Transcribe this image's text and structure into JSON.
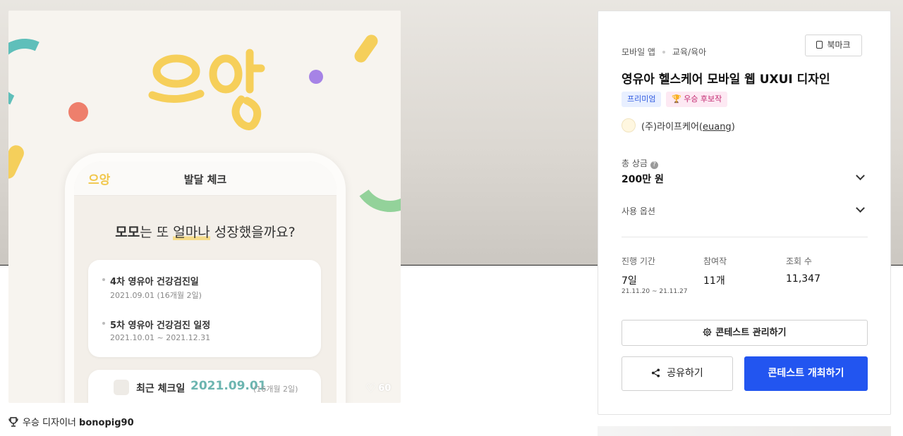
{
  "artwork": {
    "logo": "으앙",
    "phone": {
      "logo": "으앙",
      "title": "발달 체크",
      "question_name": "모모",
      "question_mid": "는 또 ",
      "question_hl": "얼마나",
      "question_end": " 성장했을까요?",
      "events": [
        {
          "title": "4차 영유아 건강검진일",
          "date": "2021.09.01 (16개월 2일)"
        },
        {
          "title": "5차 영유아 건강검진 일정",
          "date": "2021.10.01 ~ 2021.12.31"
        }
      ],
      "recent": {
        "label": "최근 체크일",
        "date": "2021.09.01",
        "sub": "(16개월 2일)"
      }
    },
    "likes": "60"
  },
  "designer": {
    "prefix": "우승 디자이너",
    "name": "bonopig90"
  },
  "panel": {
    "category": "모바일 앱",
    "subcategory": "교육/육아",
    "bookmark_label": "북마크",
    "title": "영유아 헬스케어 모바일 웹 UXUI 디자인",
    "badges": {
      "premium": "프리미엄",
      "winner": "🏆 우승 후보작"
    },
    "company": {
      "name": "(주)라이프케어",
      "handle": "euang"
    },
    "prize": {
      "label": "총 상금",
      "value": "200만 원"
    },
    "usage": {
      "label": "사용 옵션"
    },
    "stats": {
      "period": {
        "label": "진행 기간",
        "value": "7일",
        "range": "21.11.20 ~ 21.11.27"
      },
      "entries": {
        "label": "참여작",
        "value": "11개"
      },
      "views": {
        "label": "조회 수",
        "value": "11,347"
      }
    },
    "manage_label": "콘테스트 관리하기",
    "share_label": "공유하기",
    "host_label": "콘테스트 개최하기"
  },
  "colors": {
    "accent": "#2255f0",
    "brand_yellow": "#f1c74c",
    "teal_date": "#6cb5b0"
  }
}
